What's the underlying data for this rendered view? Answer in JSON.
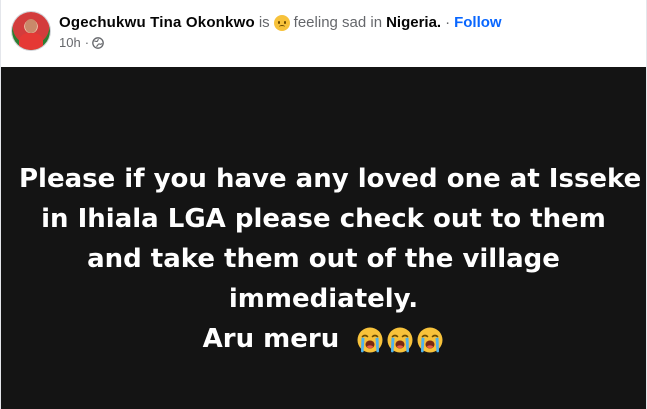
{
  "post": {
    "author": "Ogechukwu Tina Okonkwo",
    "is_word": "is",
    "feeling_icon": "sad-face-emoji-icon",
    "feeling_text": "feeling sad in",
    "location": "Nigeria.",
    "separator": "·",
    "follow_label": "Follow",
    "timestamp": "10h",
    "meta_separator": "·",
    "privacy_icon": "globe-icon"
  },
  "content": {
    "background": "#141414",
    "lines": [
      "Please if you have any loved one at Isseke",
      "in Ihiala LGA please check out to them",
      "and take them out of the village",
      "immediately.",
      "Aru meru"
    ],
    "trailing_emojis": [
      "loudly-crying-face-icon",
      "loudly-crying-face-icon",
      "loudly-crying-face-icon"
    ]
  },
  "colors": {
    "follow": "#0866ff",
    "author": "#050505",
    "meta": "#65676b",
    "text_on_dark": "#ffffff"
  }
}
